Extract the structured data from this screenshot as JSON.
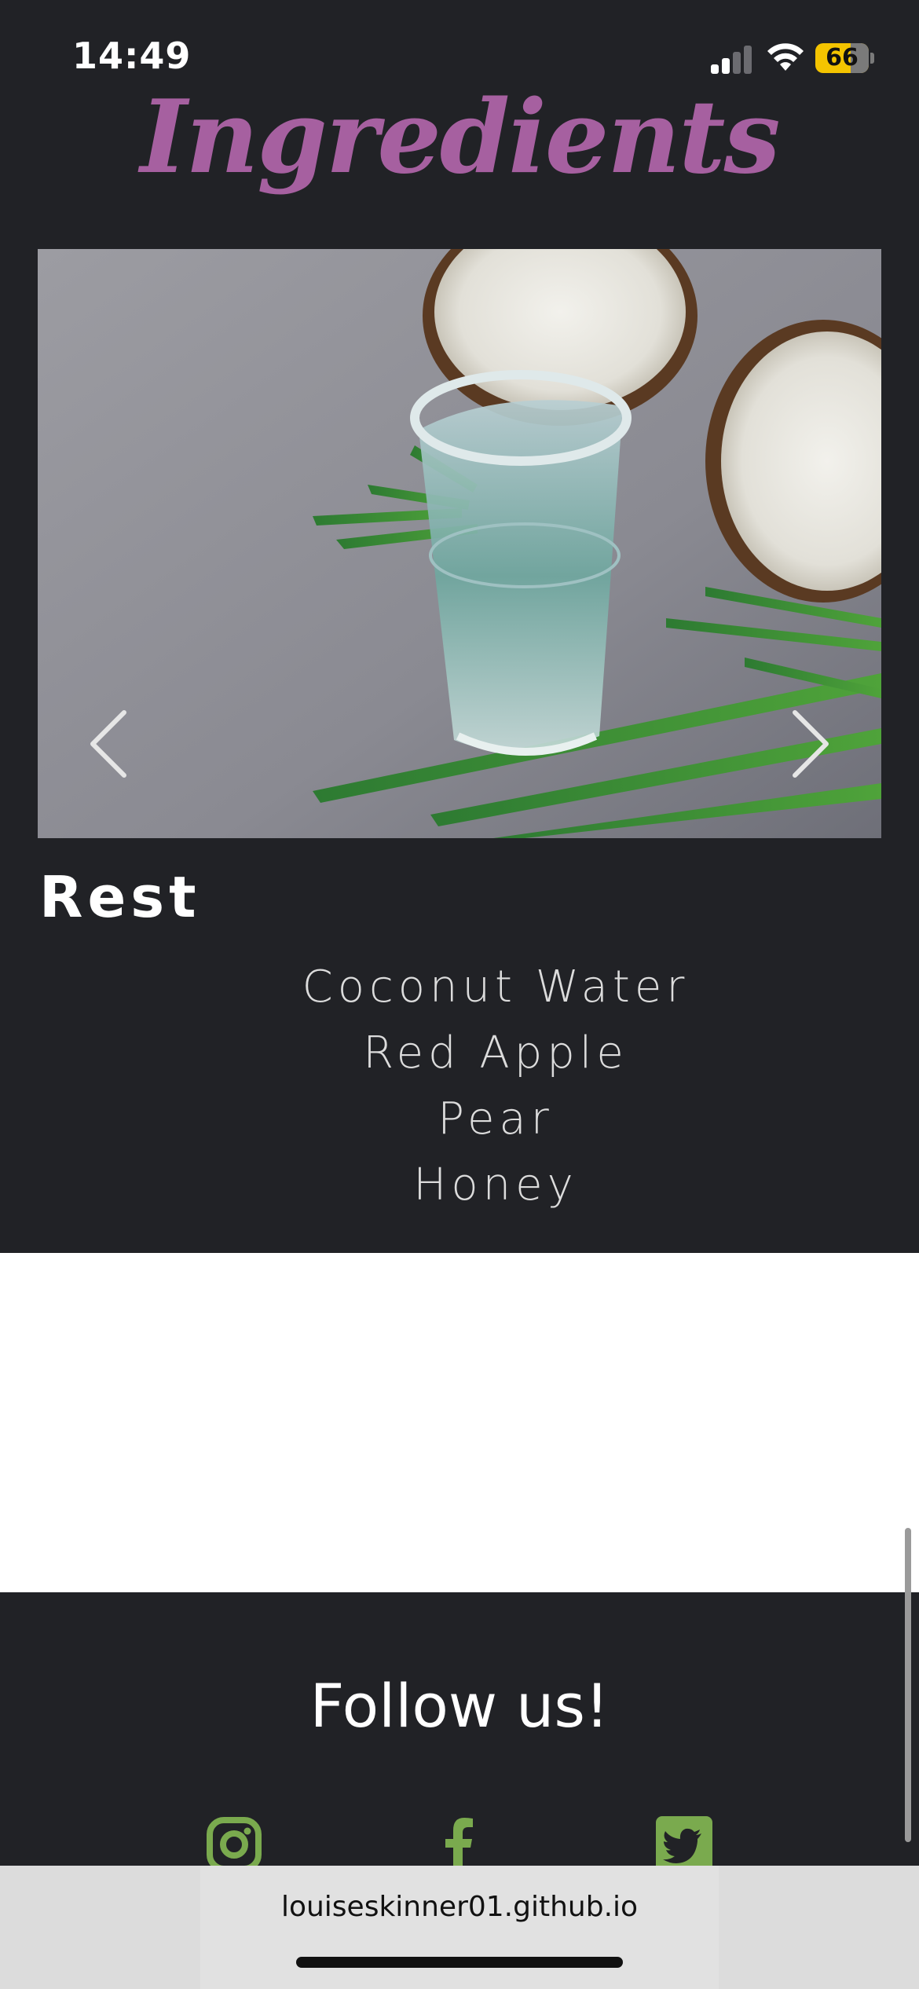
{
  "status_bar": {
    "time": "14:49",
    "battery_level": "66",
    "battery_fraction": 0.66,
    "signal_bars_active": 2,
    "signal_bars_total": 4,
    "icons": [
      "cellular-signal-icon",
      "wifi-icon",
      "battery-icon"
    ]
  },
  "section": {
    "heading": "Ingredients"
  },
  "carousel": {
    "image_subject": "glass of coconut water with coconut halves and palm leaves",
    "prev_icon": "chevron-left-icon",
    "next_icon": "chevron-right-icon",
    "slide_title": "Rest",
    "ingredients": [
      "Coconut Water",
      "Red Apple",
      "Pear",
      "Honey"
    ]
  },
  "footer": {
    "heading": "Follow us!",
    "social": [
      {
        "name": "instagram",
        "icon": "instagram-icon"
      },
      {
        "name": "facebook",
        "icon": "facebook-icon"
      },
      {
        "name": "twitter",
        "icon": "twitter-icon"
      }
    ]
  },
  "browser": {
    "url": "louiseskinner01.github.io"
  },
  "colors": {
    "background": "#212226",
    "heading_accent": "#a660a0",
    "social_green": "#7aaa4e",
    "white_section": "#ffffff",
    "address_bar": "#dcdcdc"
  }
}
